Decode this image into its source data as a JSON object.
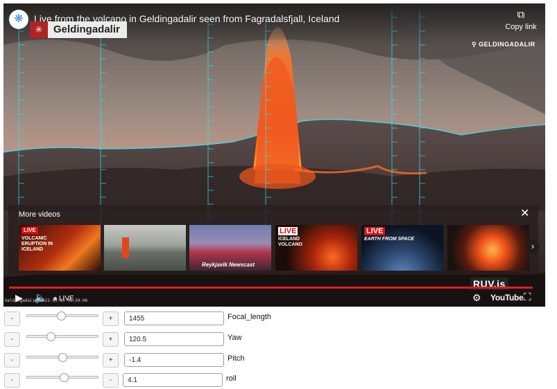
{
  "video": {
    "title": "Live from the volcano in Geldingadalir seen from Fagradalsfjall, Iceland",
    "copy_link_label": "Copy link",
    "overlay_badge_text": "Geldingadalir",
    "location_tag": "GELDINGADALIR",
    "more_videos_title": "More videos",
    "thumbnails": [
      {
        "live_tag": "LIVE",
        "caption": "VOLCANIC ERUPTION IN ICELAND"
      },
      {
        "live_tag": "",
        "caption": ""
      },
      {
        "live_tag": "",
        "caption": "Reykjavik Newscast"
      },
      {
        "live_tag": "LIVE",
        "caption": "ICELAND VOLCANO"
      },
      {
        "live_tag": "LIVE",
        "caption": "EARTH FROM SPACE"
      },
      {
        "live_tag": "",
        "caption": ""
      }
    ],
    "watermark": "RUV.is",
    "live_label": "LIVE",
    "youtube_label": "YouTube",
    "camera_stamp": "Geldingadalir 2021-03-25 05:39:06",
    "progress_percent": 100
  },
  "controls": [
    {
      "name": "focal-length",
      "label": "Focal_length",
      "value": "1455",
      "left_button": "-",
      "right_button": "+",
      "slider_fraction": 0.48
    },
    {
      "name": "yaw",
      "label": "Yaw",
      "value": "120.5",
      "left_button": "-",
      "right_button": "+",
      "slider_fraction": 0.34
    },
    {
      "name": "pitch",
      "label": "Pitch",
      "value": "-1.4",
      "left_button": "-",
      "right_button": "+",
      "slider_fraction": 0.5
    },
    {
      "name": "roll",
      "label": "roll",
      "value": "4.1",
      "left_button": "-",
      "right_button": "-",
      "slider_fraction": 0.52
    }
  ],
  "colors": {
    "accent_red": "#e01e1e",
    "overlay_cyan": "#38e0f0",
    "lava": "#f2531a"
  },
  "icons": [
    "channel-logo-icon",
    "copy-link-icon",
    "location-pin-icon",
    "close-icon",
    "chevron-right-icon",
    "play-icon",
    "volume-icon",
    "settings-icon",
    "fullscreen-icon"
  ]
}
